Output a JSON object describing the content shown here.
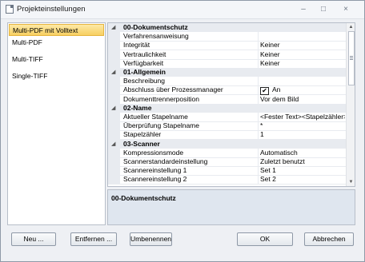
{
  "window": {
    "title": "Projekteinstellungen"
  },
  "title_controls": {
    "minimize": "–",
    "maximize": "□",
    "close": "×"
  },
  "left_list": {
    "items": [
      {
        "label": "Multi-PDF mit Volltext",
        "selected": true
      },
      {
        "label": "Multi-PDF",
        "selected": false
      },
      {
        "label": "Multi-TIFF",
        "selected": false
      },
      {
        "label": "Single-TIFF",
        "selected": false
      }
    ]
  },
  "grid": {
    "rows": [
      {
        "kind": "cat",
        "name": "00-Dokumentschutz"
      },
      {
        "kind": "prop",
        "name": "Verfahrensanweisung",
        "value": ""
      },
      {
        "kind": "prop",
        "name": "Integrität",
        "value": "Keiner"
      },
      {
        "kind": "prop",
        "name": "Vertraulichkeit",
        "value": "Keiner"
      },
      {
        "kind": "prop",
        "name": "Verfügbarkeit",
        "value": "Keiner"
      },
      {
        "kind": "cat",
        "name": "01-Allgemein"
      },
      {
        "kind": "prop",
        "name": "Beschreibung",
        "value": ""
      },
      {
        "kind": "prop",
        "name": "Abschluss über Prozessmanager",
        "value": "An",
        "checkbox": true
      },
      {
        "kind": "prop",
        "name": "Dokumenttrennerposition",
        "value": "Vor dem Bild"
      },
      {
        "kind": "cat",
        "name": "02-Name"
      },
      {
        "kind": "prop",
        "name": "Aktueller Stapelname",
        "value": "<Fester Text><Stapelzähler>"
      },
      {
        "kind": "prop",
        "name": "Überprüfung Stapelname",
        "value": "*"
      },
      {
        "kind": "prop",
        "name": "Stapelzähler",
        "value": "1"
      },
      {
        "kind": "cat",
        "name": "03-Scanner"
      },
      {
        "kind": "prop",
        "name": "Kompressionsmode",
        "value": "Automatisch"
      },
      {
        "kind": "prop",
        "name": "Scannerstandardeinstellung",
        "value": "Zuletzt benutzt"
      },
      {
        "kind": "prop",
        "name": "Scannereinstellung 1",
        "value": "Set 1"
      },
      {
        "kind": "prop",
        "name": "Scannereinstellung 2",
        "value": "Set 2"
      }
    ],
    "checkbox_mark": "✔",
    "collapse_glyph": "◢",
    "scroll_up": "▲",
    "scroll_down": "▼"
  },
  "description": {
    "title": "00-Dokumentschutz"
  },
  "buttons": {
    "neu": "Neu ...",
    "entfernen": "Entfernen ...",
    "umbenennen": "Umbenennen",
    "ok": "OK",
    "abbrechen": "Abbrechen"
  }
}
